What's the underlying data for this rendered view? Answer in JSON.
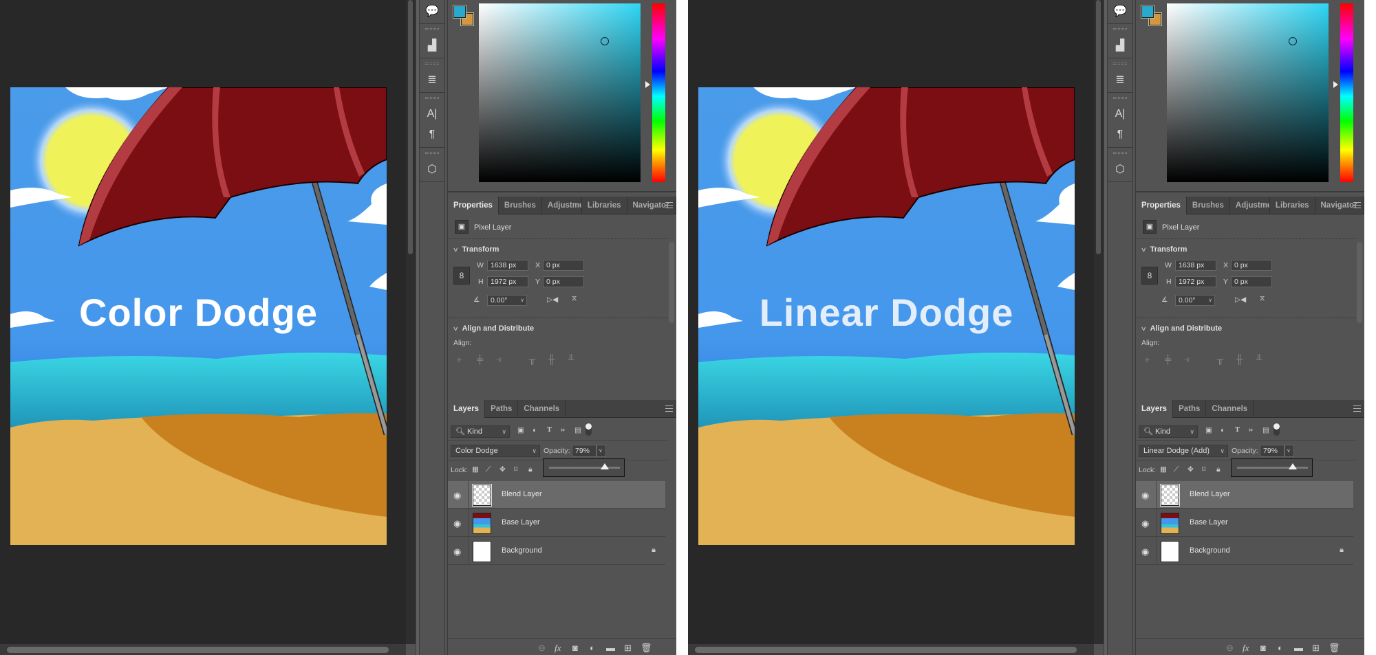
{
  "colors": {
    "foreground": "#2aa9cc",
    "background": "#d6973a",
    "picker_hue": "#2fd6f5"
  },
  "tool_icons": [
    "comments-icon",
    "histogram-icon",
    "brush-settings-icon",
    "character-icon",
    "paragraph-icon",
    "3d-icon"
  ],
  "properties": {
    "tabs": [
      "Properties",
      "Brushes",
      "Adjustme",
      "Libraries",
      "Navigator"
    ],
    "active_tab": "Properties",
    "layer_kind": "Pixel Layer",
    "transform": {
      "heading": "Transform",
      "w_label": "W",
      "w_value": "1638 px",
      "h_label": "H",
      "h_value": "1972 px",
      "x_label": "X",
      "x_value": "0 px",
      "y_label": "Y",
      "y_value": "0 px",
      "angle_value": "0.00°"
    },
    "align": {
      "heading": "Align and Distribute",
      "align_label": "Align:"
    }
  },
  "layers_panel": {
    "tabs": [
      "Layers",
      "Paths",
      "Channels"
    ],
    "active_tab": "Layers",
    "filter_kind": "Kind",
    "opacity_label": "Opacity:",
    "lock_label": "Lock:",
    "footer_icons": [
      "link-layers-icon",
      "fx-icon",
      "add-mask-icon",
      "adjustment-layer-icon",
      "new-group-icon",
      "new-layer-icon",
      "delete-layer-icon"
    ]
  },
  "documents": [
    {
      "title_text": "Color Dodge",
      "title_color": "#ffffff",
      "blend_mode": "Color Dodge",
      "opacity": "79%",
      "opacity_fraction": 0.79,
      "layers": [
        {
          "name": "Blend Layer",
          "selected": true,
          "locked": false,
          "thumb": "transparent"
        },
        {
          "name": "Base Layer",
          "selected": false,
          "locked": false,
          "thumb": "beach"
        },
        {
          "name": "Background",
          "selected": false,
          "locked": true,
          "thumb": "white"
        }
      ]
    },
    {
      "title_text": "Linear Dodge",
      "title_color": "#e4eefa",
      "blend_mode": "Linear Dodge (Add)",
      "opacity": "79%",
      "opacity_fraction": 0.79,
      "layers": [
        {
          "name": "Blend Layer",
          "selected": true,
          "locked": false,
          "thumb": "transparent"
        },
        {
          "name": "Base Layer",
          "selected": false,
          "locked": false,
          "thumb": "beach"
        },
        {
          "name": "Background",
          "selected": false,
          "locked": true,
          "thumb": "white"
        }
      ]
    }
  ]
}
